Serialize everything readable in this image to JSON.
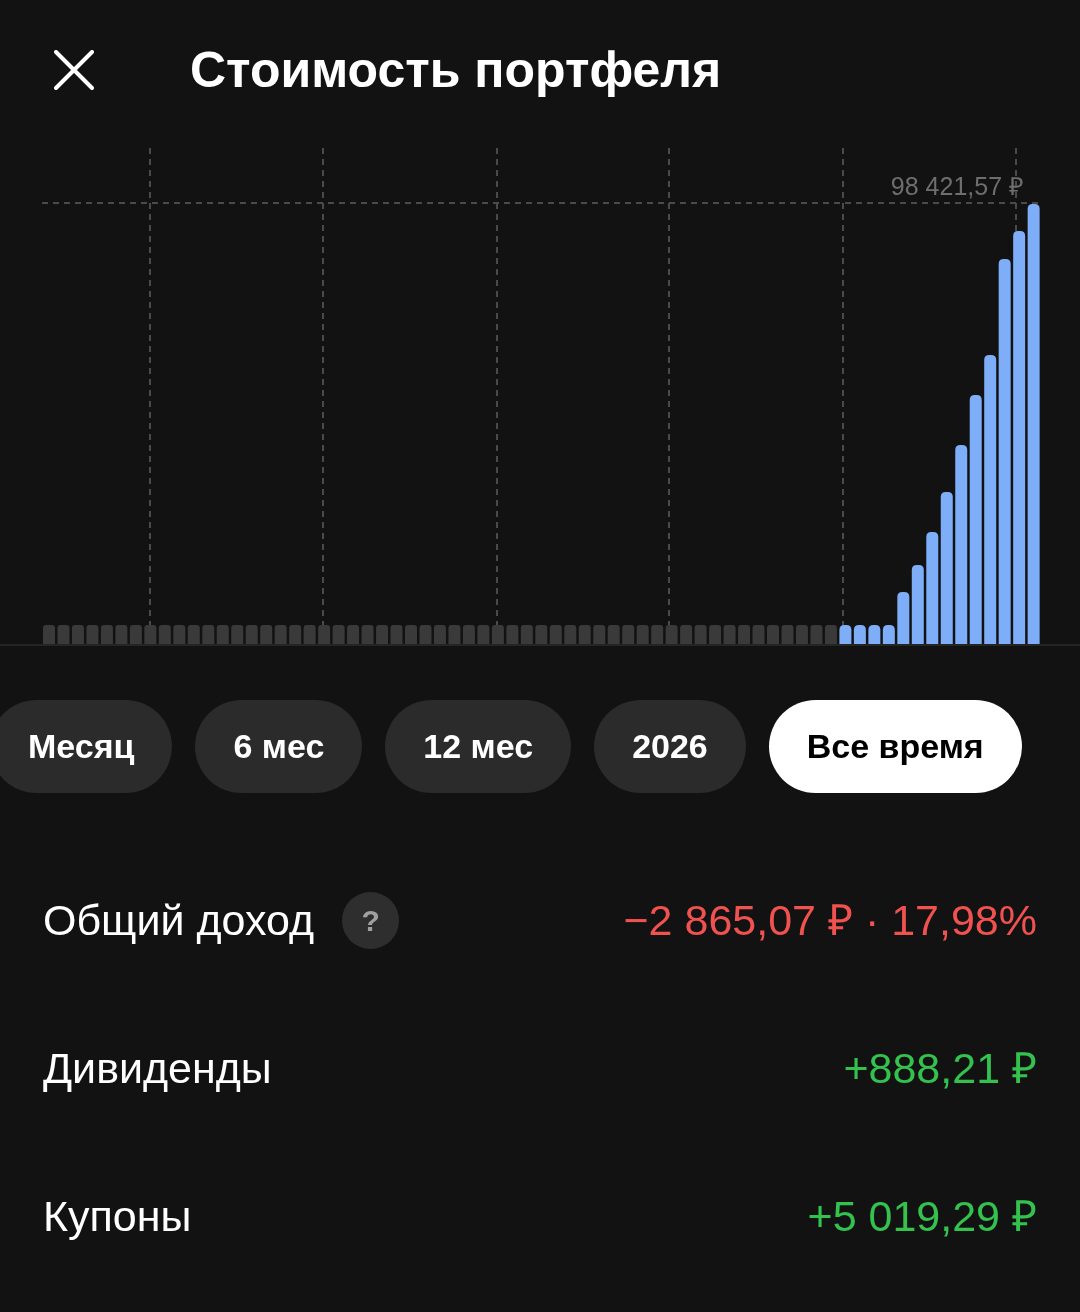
{
  "header": {
    "title": "Стоимость портфеля"
  },
  "chart": {
    "max_label": "98 421,57 ₽"
  },
  "periods": [
    {
      "label": "Месяц",
      "selected": false
    },
    {
      "label": "6 мес",
      "selected": false
    },
    {
      "label": "12 мес",
      "selected": false
    },
    {
      "label": "2026",
      "selected": false
    },
    {
      "label": "Все время",
      "selected": true
    }
  ],
  "stats": [
    {
      "label": "Общий доход",
      "help": "?",
      "value": "−2 865,07 ₽ · 17,98%",
      "color": "#f0524f"
    },
    {
      "label": "Дивиденды",
      "value": "+888,21 ₽",
      "color": "#34c24f"
    },
    {
      "label": "Купоны",
      "value": "+5 019,29 ₽",
      "color": "#34c24f"
    }
  ]
}
